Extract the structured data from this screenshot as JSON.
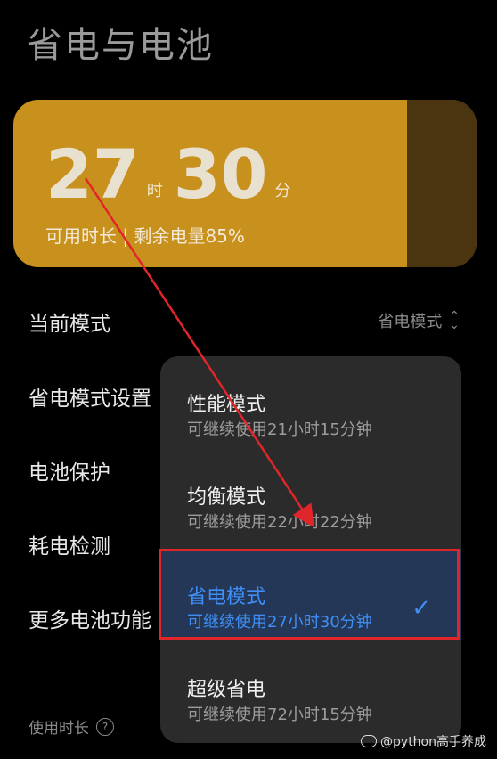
{
  "page": {
    "title": "省电与电池"
  },
  "battery": {
    "hours": "27",
    "hour_unit": "时",
    "minutes": "30",
    "minute_unit": "分",
    "subtitle": "可用时长 | 剩余电量85%",
    "level_percent": 85,
    "color": "#c8901c"
  },
  "settings": {
    "current_mode_label": "当前模式",
    "current_mode_value": "省电模式",
    "power_saving_settings": "省电模式设置",
    "battery_protection": "电池保护",
    "power_detection": "耗电检测",
    "more_features": "更多电池功能",
    "usage_duration": "使用时长"
  },
  "menu": {
    "options": [
      {
        "name": "性能模式",
        "desc": "可继续使用21小时15分钟"
      },
      {
        "name": "均衡模式",
        "desc": "可继续使用22小时22分钟"
      },
      {
        "name": "省电模式",
        "desc": "可继续使用27小时30分钟",
        "selected": true
      },
      {
        "name": "超级省电",
        "desc": "可继续使用72小时15分钟"
      }
    ]
  },
  "watermark": "@python高手养成",
  "colors": {
    "accent": "#3f8ef5",
    "annotation": "#e0262a",
    "menu_bg": "#2b2b2b"
  }
}
